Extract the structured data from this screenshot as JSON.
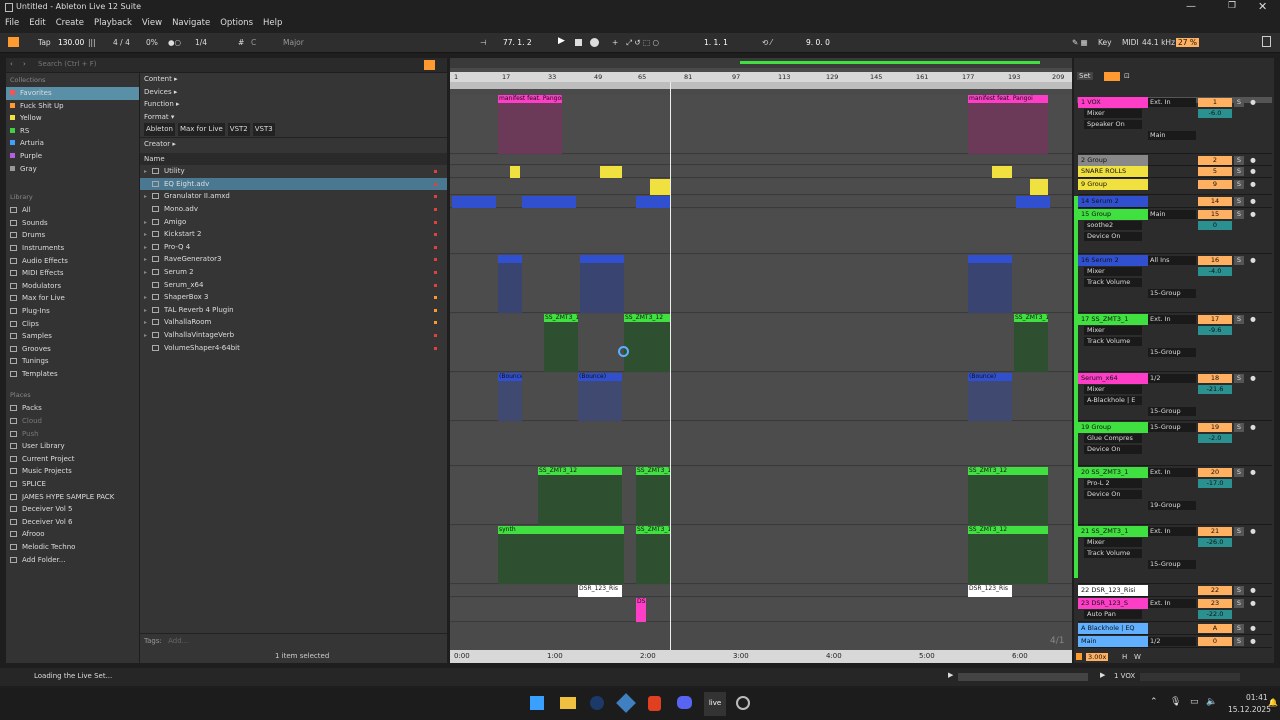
{
  "window": {
    "title": "Untitled - Ableton Live 12 Suite"
  },
  "menu": [
    "File",
    "Edit",
    "Create",
    "Playback",
    "View",
    "Navigate",
    "Options",
    "Help"
  ],
  "control": {
    "tap": "Tap",
    "tempo": "130.00",
    "timesig": "4 / 4",
    "swing": "0%",
    "quant": "1/4",
    "key": "C",
    "scale": "Major",
    "position": "77.  1.  2",
    "loop_start": "1.  1.  1",
    "loop_len": "9.  0.  0",
    "key_btn": "Key",
    "midi_btn": "MIDI",
    "sample_rate": "44.1 kHz",
    "cpu": "27 %"
  },
  "browser": {
    "search_placeholder": "Search (Ctrl + F)",
    "collections_title": "Collections",
    "collections": [
      {
        "label": "Favorites",
        "color": "#ff5050"
      },
      {
        "label": "Fuck Shit Up",
        "color": "#ff9a30"
      },
      {
        "label": "Yellow",
        "color": "#f0e040"
      },
      {
        "label": "RS",
        "color": "#40d040"
      },
      {
        "label": "Arturia",
        "color": "#40a0ff"
      },
      {
        "label": "Purple",
        "color": "#b060e0"
      },
      {
        "label": "Gray",
        "color": "#999999"
      }
    ],
    "library_title": "Library",
    "library": [
      "All",
      "Sounds",
      "Drums",
      "Instruments",
      "Audio Effects",
      "MIDI Effects",
      "Modulators",
      "Max for Live",
      "Plug-Ins",
      "Clips",
      "Samples",
      "Grooves",
      "Tunings",
      "Templates"
    ],
    "places_title": "Places",
    "places": [
      "Packs",
      "Cloud",
      "Push",
      "User Library",
      "Current Project",
      "Music Projects",
      "SPLICE",
      "JAMES HYPE SAMPLE PACK",
      "Deceiver Vol 5",
      "Deceiver Vol 6",
      "Afrooo",
      "Melodic Techno",
      "Add Folder..."
    ],
    "filters": [
      "Content",
      "Devices",
      "Function",
      "Format"
    ],
    "format_tags": [
      "Ableton",
      "Max for Live",
      "VST2",
      "VST3"
    ],
    "creator": "Creator",
    "name_header": "Name",
    "files": [
      "Utility",
      "EQ Eight.adv",
      "Granulator II.amxd",
      "Mono.adv",
      "Amigo",
      "Kickstart 2",
      "Pro-Q 4",
      "RaveGenerator3",
      "Serum 2",
      "Serum_x64",
      "ShaperBox 3",
      "TAL Reverb 4 Plugin",
      "ValhallaRoom",
      "ValhallaVintageVerb",
      "VolumeShaper4-64bit"
    ],
    "tags_label": "Tags:",
    "tags_add": "Add...",
    "selected_status": "1 item selected"
  },
  "ruler": [
    "1",
    "17",
    "33",
    "49",
    "65",
    "81",
    "97",
    "113",
    "129",
    "145",
    "161",
    "177",
    "193",
    "209"
  ],
  "time_ruler": [
    "0:00",
    "1:00",
    "2:00",
    "3:00",
    "4:00",
    "5:00",
    "6:00"
  ],
  "tracks": [
    {
      "name": "1 VOX",
      "color": "#ff3ec8",
      "num": "1",
      "in": "Ext. In",
      "vol": "-6.0",
      "sub1": "Mixer",
      "sub2": "Speaker On",
      "route": "Main"
    },
    {
      "name": "2 Group",
      "color": "#888888",
      "num": "2"
    },
    {
      "name": "SNARE ROLLS",
      "color": "#f0e040",
      "num": "5"
    },
    {
      "name": "9 Group",
      "color": "#f0e040",
      "num": "9"
    },
    {
      "name": "14 Serum 2",
      "color": "#3050d0",
      "num": "14"
    },
    {
      "name": "15 Group",
      "color": "#40e040",
      "num": "15",
      "in": "Main",
      "vol": "0",
      "sub1": "soothe2",
      "sub2": "Device On"
    },
    {
      "name": "16 Serum 2",
      "color": "#3050d0",
      "num": "16",
      "in": "All Ins",
      "vol": "-4.0",
      "sub1": "Mixer",
      "sub2": "Track Volume",
      "route": "15-Group"
    },
    {
      "name": "17 SS_ZMT3_1",
      "color": "#40e040",
      "num": "17",
      "in": "Ext. In",
      "vol": "-9.6",
      "sub1": "Mixer",
      "sub2": "Track Volume",
      "route": "15-Group"
    },
    {
      "name": "Serum_x64",
      "color": "#ff3ec8",
      "num": "18",
      "in": "1/2",
      "vol": "-21.6",
      "sub1": "Mixer",
      "sub2": "A-Blackhole | E",
      "route": "15-Group"
    },
    {
      "name": "19 Group",
      "color": "#40e040",
      "num": "19",
      "in": "15-Group",
      "vol": "-2.0",
      "sub1": "Glue Compres",
      "sub2": "Device On"
    },
    {
      "name": "20 SS_ZMT3_1",
      "color": "#40e040",
      "num": "20",
      "in": "Ext. In",
      "vol": "-17.0",
      "sub1": "Pro-L 2",
      "sub2": "Device On",
      "route": "19-Group"
    },
    {
      "name": "21 SS_ZMT3_1",
      "color": "#40e040",
      "num": "21",
      "in": "Ext. In",
      "vol": "-26.0",
      "sub1": "Mixer",
      "sub2": "Track Volume",
      "route": "15-Group"
    },
    {
      "name": "22 DSR_123_Risi",
      "color": "#ffffff",
      "num": "22"
    },
    {
      "name": "23 DSR_123_S",
      "color": "#ff3ec8",
      "num": "23",
      "in": "Ext. In",
      "vol": "-22.0",
      "sub1": "Auto Pan"
    },
    {
      "name": "A Blackhole | EQ",
      "color": "#60b0ff",
      "num": "A"
    },
    {
      "name": "Main",
      "color": "#60b0ff",
      "num": "0",
      "in": "1/2"
    }
  ],
  "clips": {
    "vox": "manifest feat. Pangoi",
    "bounce": "(Bounce)",
    "ss": "SS_ZMT3_12",
    "synth": "synth",
    "dsr": "DSR_123_Ris",
    "ds": "DS"
  },
  "mixer": {
    "set": "Set",
    "tab_main": "Main",
    "auto": "Auto",
    "off": "Off",
    "in": "In",
    "zoom": "3.00x",
    "hw": "H",
    "w": "W",
    "sig": "4/1"
  },
  "status": {
    "loading": "Loading the Live Set...",
    "selected_track": "1 VOX"
  },
  "clock": {
    "time": "01:41",
    "date": "15.12.2025"
  }
}
